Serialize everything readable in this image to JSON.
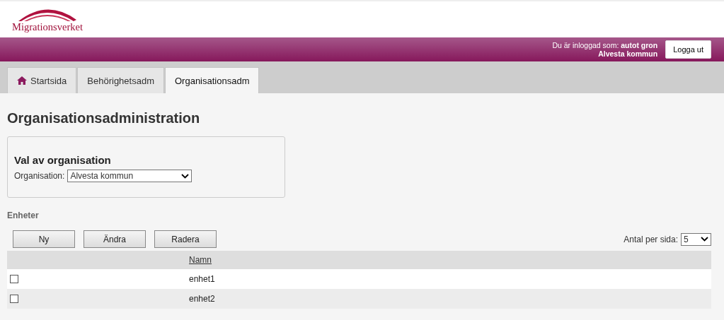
{
  "logo": {
    "text": "Migrationsverket"
  },
  "user_bar": {
    "logged_in_label": "Du är inloggad som:",
    "user": "autot gron",
    "organisation": "Alvesta kommun",
    "logout_button": "Logga ut"
  },
  "tabs": [
    {
      "label": "Startsida",
      "kind": "with_icon",
      "selected": false
    },
    {
      "label": "Behörighetsadm",
      "kind": "plain",
      "selected": false
    },
    {
      "label": "Organisationsadm",
      "kind": "plain",
      "selected": true
    }
  ],
  "page_title": "Organisationsadministration",
  "org_panel": {
    "title": "Val av organisation",
    "label": "Organisation:",
    "value": "Alvesta kommun"
  },
  "section_title": "Enheter",
  "buttons": [
    "Ny",
    "Ändra",
    "Radera"
  ],
  "per_page": {
    "label": "Antal per sida:",
    "value": "5"
  },
  "table": {
    "columns": [
      "Namn"
    ],
    "rows": [
      {
        "checked": false,
        "name": "enhet1"
      },
      {
        "checked": false,
        "name": "enhet2"
      }
    ]
  }
}
